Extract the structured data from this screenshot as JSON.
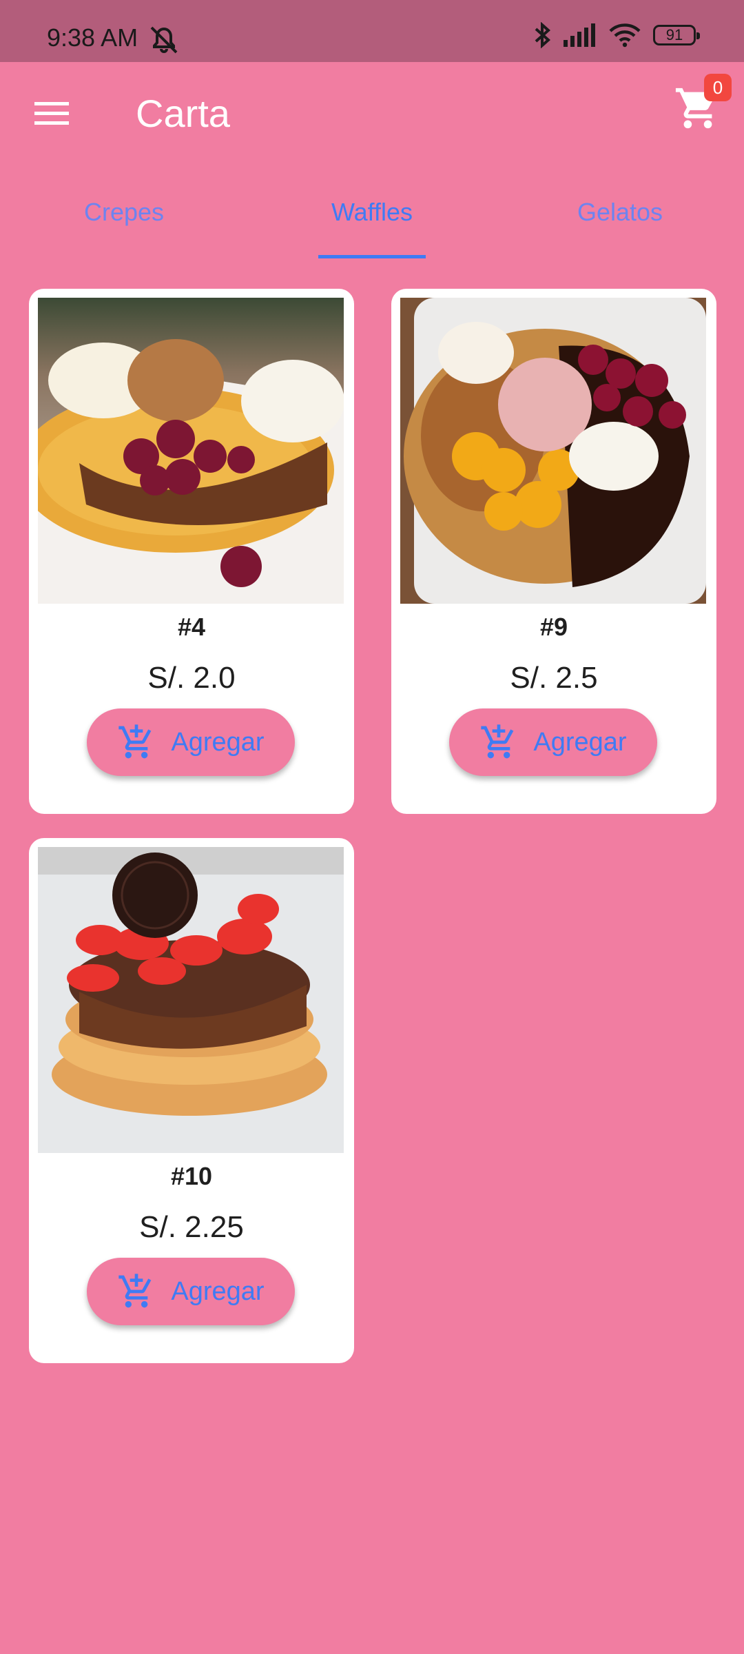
{
  "status_bar": {
    "time": "9:38 AM",
    "battery": "91"
  },
  "app_bar": {
    "title": "Carta",
    "cart_count": "0"
  },
  "tabs": [
    {
      "label": "Crepes",
      "active": false
    },
    {
      "label": "Waffles",
      "active": true
    },
    {
      "label": "Gelatos",
      "active": false
    }
  ],
  "products": [
    {
      "name": "#4",
      "price": "S/. 2.0",
      "button": "Agregar"
    },
    {
      "name": "#9",
      "price": "S/. 2.5",
      "button": "Agregar"
    },
    {
      "name": "#10",
      "price": "S/. 2.25",
      "button": "Agregar"
    }
  ],
  "colors": {
    "background": "#F17DA1",
    "status_bar": "#B35D7B",
    "accent": "#3F7BF4",
    "badge": "#F2473F"
  },
  "icons": [
    "menu-icon",
    "cart-icon",
    "add-shopping-cart-icon",
    "bluetooth-icon",
    "signal-icon",
    "wifi-icon",
    "mute-icon"
  ]
}
